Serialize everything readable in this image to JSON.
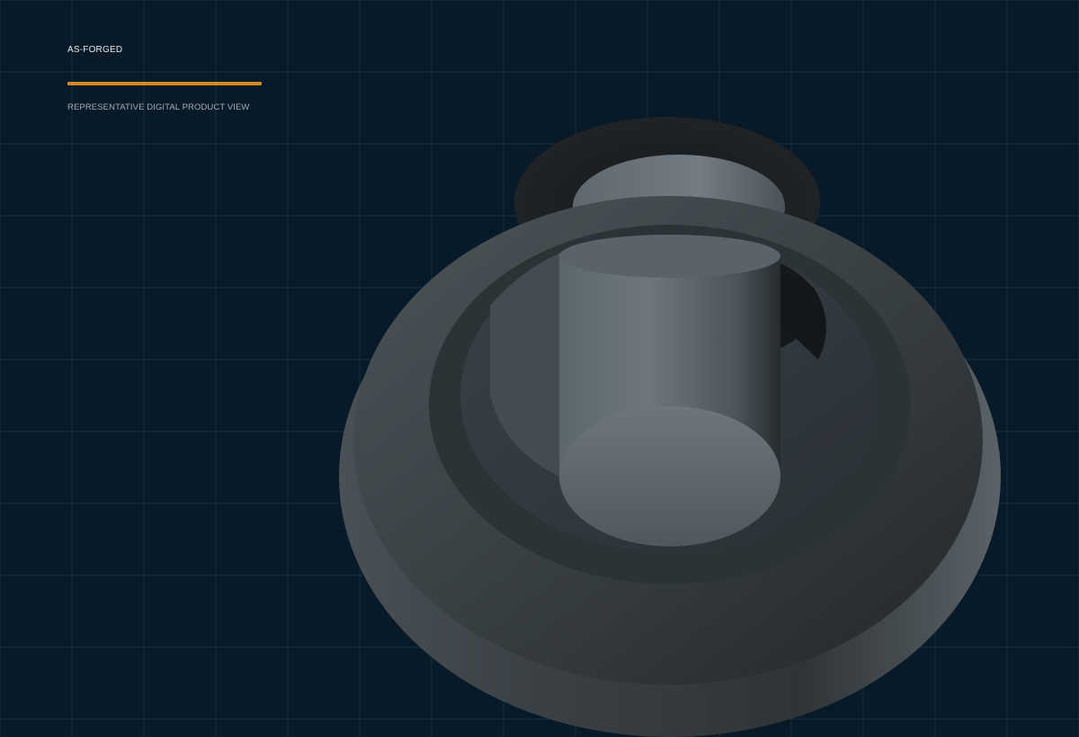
{
  "header": {
    "title": "AS-FORGED",
    "subtitle": "REPRESENTATIVE DIGITAL PRODUCT VIEW"
  },
  "colors": {
    "background": "#081a27",
    "grid": "#17303f",
    "accent": "#d08a26",
    "metal_dark": "#2b2e30",
    "metal_light": "#6f787e"
  },
  "icons": {
    "part_render": "forged-part-icon"
  }
}
